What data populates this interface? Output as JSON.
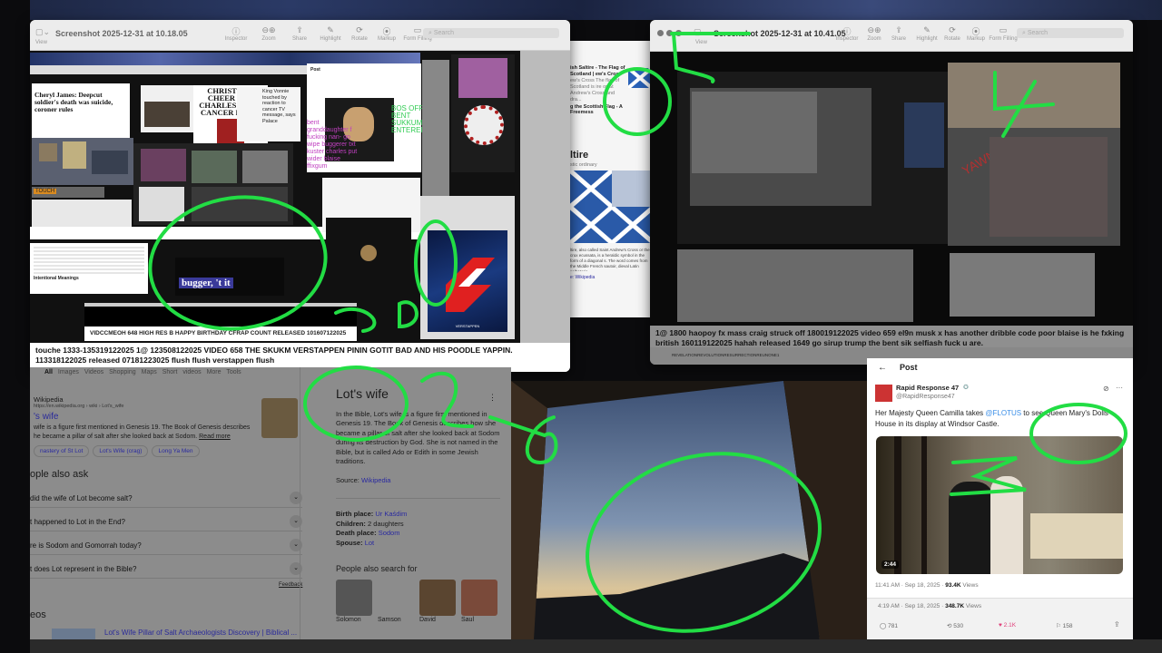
{
  "left_window": {
    "title": "Screenshot 2025-12-31 at 10.18.05",
    "toolbar": [
      "View",
      "Inspector",
      "Zoom",
      "Share",
      "Highlight",
      "Rotate",
      "Markup",
      "Form Filling"
    ],
    "search_placeholder": "Search",
    "search_label": "Search",
    "collage": {
      "headline_1": "Cheryl James: Deepcut soldier's death was suicide, coroner rules",
      "headline_2": "CHRISTMAS CHEER FOR CHARLES IN HIS CANCER FIGHT",
      "headline_3": "King Vonnie touched by reaction to cancer TV message, says Palace",
      "tag_touch": "TOUCH",
      "bugger_text": "bugger, 't it",
      "magenta_note": "bent granddaughter f fucking nan- go wipe buggerer txt kuster charles put wider blaise ffixgum",
      "green_note": "BOS OFF BENT SUKKUM ENTERER",
      "sub_caption": "VIDCCMEOH 648 HIGH RES B HAPPY BIRTHDAY CFRAP COUNT RELEASED 101607122025",
      "intentional": "Intentional Meanings",
      "post_label": "Post",
      "card_text": "VERSTAPPEN"
    },
    "caption": "touche 1333-135319122025 1@ 123508122025 VIDEO 658 THE SKUKM VERSTAPPEN PININ GOTIT BAD AND HIS POODLE YAPPIN. 113318122025 released 07181223025 flush flush verstappen flush"
  },
  "middle_panel": {
    "result_1_title": "ish Saltire - The Flag of Scotland | ew's Cross",
    "result_1_snippet": "ew's Cross The flag of Scotland is ire or St Andrew's Cross and dra...",
    "result_2_title": "g the Scottish Flag - A Freemess",
    "heading": "ltire",
    "sub": "stic ordinary",
    "desc": "ltire, also called Saint Andrew's Cross or the crux ecussata, is a heraldic symbol in the form of a diagonal s. The word comes from the Middle French sautoir, dieval Latin salhatoria.",
    "source": "e: Wikipedia"
  },
  "right_window": {
    "title": "Screenshot 2025-12-31 at 10.41.05",
    "toolbar": [
      "View",
      "Inspector",
      "Zoom",
      "Share",
      "Highlight",
      "Rotate",
      "Markup",
      "Form Filling"
    ],
    "search_placeholder": "Search",
    "search_label": "Search",
    "collage_note": "YAWN",
    "caption": "1@ 1800 haopoy fx mass craig struck off 180019122025 video 659 el9n musk x has another dribble code poor blaise is he fxking british 160119122025 hahah released 1649 go sirup trump the bent sik selfiash fuck u are.",
    "channel": "REVELATIONREVOLUTIONRESURRECTIONREUNONE1"
  },
  "google": {
    "tabs": [
      "All",
      "Images",
      "Videos",
      "Shopping",
      "Maps",
      "Short videos",
      "More",
      "Tools"
    ],
    "result": {
      "source": "Wikipedia",
      "url": "https://en.wikipedia.org › wiki › Lot's_wife",
      "title": "'s wife",
      "snippet": "wife is a figure first mentioned in Genesis 19. The Book of Genesis describes he became a pillar of salt after she looked back at Sodom.",
      "read_more": "Read more",
      "chips": [
        "nastery of St Lot",
        "Lot's Wife (crag)",
        "Long Ya Men"
      ]
    },
    "paa_title": "ople also ask",
    "paa": [
      "did the wife of Lot become salt?",
      "t happened to Lot in the End?",
      "re is Sodom and Gomorrah today?",
      "t does Lot represent in the Bible?"
    ],
    "feedback": "Feedback",
    "videos_title": "eos",
    "video_title": "Lot's Wife Pillar of Salt Archaeologists Discovery | Biblical ...",
    "knowledge_panel": {
      "title": "Lot's wife",
      "description": "In the Bible, Lot's wife is a figure first mentioned in Genesis 19. The Book of Genesis describes how she became a pillar of salt after she looked back at Sodom during its destruction by God. She is not named in the Bible, but is called Ado or Edith in some Jewish traditions.",
      "source_label": "Source:",
      "source_link": "Wikipedia",
      "facts": [
        {
          "label": "Birth place:",
          "value": "Ur Kaśdim"
        },
        {
          "label": "Children:",
          "value": "2 daughters"
        },
        {
          "label": "Death place:",
          "value": "Sodom"
        },
        {
          "label": "Spouse:",
          "value": "Lot"
        }
      ],
      "also_search": "People also search for",
      "people": [
        "Solomon",
        "Samson",
        "David",
        "Saul"
      ]
    }
  },
  "tweet": {
    "header": "Post",
    "author": "Rapid Response 47",
    "handle": "@RapidResponse47",
    "text_before": "Her Majesty Queen Camilla takes ",
    "mention": "@FLOTUS",
    "text_after": " to see Queen Mary's Dolls' House in its display at Windsor Castle.",
    "video_duration": "2:44",
    "meta_time": "11:41 AM · Sep 18, 2025 · ",
    "meta_views": "93.4K",
    "views_label": " Views",
    "outer_time": "4:19 AM · Sep 18, 2025 · ",
    "outer_views": "348.7K",
    "actions": {
      "replies": "781",
      "reposts": "530",
      "likes": "2.1K",
      "bookmarks": "158"
    }
  },
  "annotations": {
    "green_numbers": [
      "5",
      "4",
      "2",
      "6",
      "3",
      "1",
      "50"
    ],
    "color_green": "#22dd44",
    "color_magenta": "#cc44cc"
  }
}
